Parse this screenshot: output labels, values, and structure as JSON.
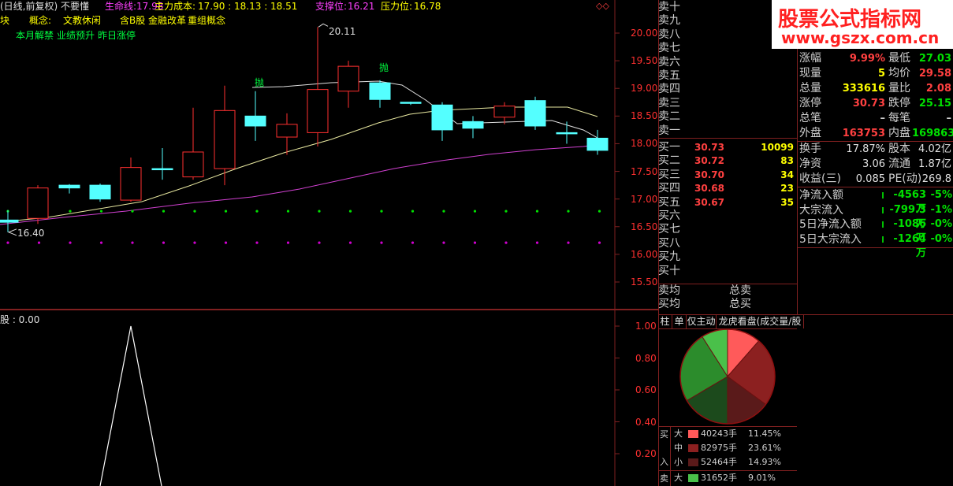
{
  "header": {
    "title": "(日线,前复权) 不要懂",
    "lifeline_label": "生命线:",
    "lifeline_value": "17.98",
    "cost_label": "主力成本:",
    "cost_value": "17.90 : 18.13 : 18.51",
    "support_label": "支撑位:",
    "support_value": "16.21",
    "pressure_label": "压力位:",
    "pressure_value": "16.78",
    "corner_icon": "◇◇"
  },
  "concept_line": {
    "prefix": "块",
    "concept_label": "概念:",
    "items": [
      "文教休闲",
      "含B股",
      "金融改革",
      "重组概念"
    ]
  },
  "tag_line": [
    "本月解禁",
    "业绩预升",
    "昨日涨停"
  ],
  "price_axis": [
    "20.00",
    "19.50",
    "19.00",
    "18.50",
    "18.00",
    "17.50",
    "17.00",
    "16.50",
    "16.00",
    "15.50"
  ],
  "annotations": {
    "high": "20.11",
    "low": "16.40",
    "sell_signal": "抛"
  },
  "indicator": {
    "label": "股 : 0.00",
    "axis": [
      "1.00",
      "0.80",
      "0.60",
      "0.40",
      "0.20"
    ]
  },
  "order_book": {
    "sell_labels": [
      "卖十",
      "卖九",
      "卖八",
      "卖七",
      "卖六",
      "卖五",
      "卖四",
      "卖三",
      "卖二",
      "卖一"
    ],
    "buy_labels": [
      "买一",
      "买二",
      "买三",
      "买四",
      "买五",
      "买六",
      "买七",
      "买八",
      "买九",
      "买十"
    ],
    "buy_prices": [
      "30.73",
      "30.72",
      "30.70",
      "30.68",
      "30.67"
    ],
    "buy_volumes": [
      "10099",
      "83",
      "34",
      "23",
      "35"
    ],
    "avg_sell": "卖均",
    "avg_buy": "买均",
    "total_sell": "总卖",
    "total_buy": "总买"
  },
  "watermark": {
    "title": "股票公式指标网",
    "url": "www.gszx.com.cn"
  },
  "quote": [
    {
      "l1": "涨幅",
      "v1": "9.99%",
      "l2": "最低",
      "v2": "27.03",
      "c1": "#ff4040",
      "c2": "#00e000"
    },
    {
      "l1": "现量",
      "v1": "5",
      "l2": "均价",
      "v2": "29.58",
      "c1": "#ffff00",
      "c2": "#ff4040"
    },
    {
      "l1": "总量",
      "v1": "333616",
      "l2": "量比",
      "v2": "2.08",
      "c1": "#ffff00",
      "c2": "#ff4040"
    },
    {
      "l1": "涨停",
      "v1": "30.73",
      "l2": "跌停",
      "v2": "25.15",
      "c1": "#ff4040",
      "c2": "#00e000"
    },
    {
      "l1": "总笔",
      "v1": "–",
      "l2": "每笔",
      "v2": "–",
      "c1": "#d0d0d0",
      "c2": "#d0d0d0"
    },
    {
      "l1": "外盘",
      "v1": "163753",
      "l2": "内盘",
      "v2": "169863",
      "c1": "#ff4040",
      "c2": "#00e000"
    }
  ],
  "finance": [
    {
      "l1": "换手",
      "v1": "17.87%",
      "l2": "股本",
      "v2": "4.02亿"
    },
    {
      "l1": "净资",
      "v1": "3.06",
      "l2": "流通",
      "v2": "1.87亿"
    },
    {
      "l1": "收益(三)",
      "v1": "0.085",
      "l2": "PE(动)",
      "v2": "269.8"
    }
  ],
  "money_flow": [
    {
      "label": "净流入额",
      "value": "-4563万",
      "pct": "-5%"
    },
    {
      "label": "大宗流入",
      "value": "-799.3万",
      "pct": "-1%"
    },
    {
      "label": "5日净流入额",
      "value": "-1086万",
      "pct": "-0%"
    },
    {
      "label": "5日大宗流入",
      "value": "-1264万",
      "pct": "-0%"
    }
  ],
  "tabs": [
    "柱",
    "单",
    "仅主动",
    "龙虎看盘(成交量/股"
  ],
  "pie": {
    "slices": [
      {
        "name": "买入大",
        "pct": 11.45,
        "color": "#ff5a5a"
      },
      {
        "name": "买入中",
        "pct": 23.61,
        "color": "#8c2020"
      },
      {
        "name": "买入小",
        "pct": 14.93,
        "color": "#5a1a1a"
      },
      {
        "name": "卖出小",
        "pct": 16.5,
        "color": "#1c4a1c"
      },
      {
        "name": "卖出中",
        "pct": 24.5,
        "color": "#2c8c2c"
      },
      {
        "name": "卖出大",
        "pct": 9.01,
        "color": "#4ac04a"
      }
    ]
  },
  "legend": {
    "buy_side": [
      "买",
      "入"
    ],
    "sell_side": "卖",
    "rows": [
      {
        "size": "大",
        "vol": "40243手",
        "pct": "11.45%",
        "color": "#ff5a5a"
      },
      {
        "size": "中",
        "vol": "82975手",
        "pct": "23.61%",
        "color": "#8c2020"
      },
      {
        "size": "小",
        "vol": "52464手",
        "pct": "14.93%",
        "color": "#5a1a1a"
      },
      {
        "size": "大",
        "vol": "31652手",
        "pct": "9.01%",
        "color": "#4ac04a"
      }
    ]
  },
  "colors": {
    "up": "#ff3030",
    "down": "#54ffff",
    "grid": "#802020",
    "ma_yellow": "#e8e8a0",
    "ma_purple": "#d040d0",
    "dots_green": "#00e000",
    "dots_purple": "#d000d0"
  }
}
